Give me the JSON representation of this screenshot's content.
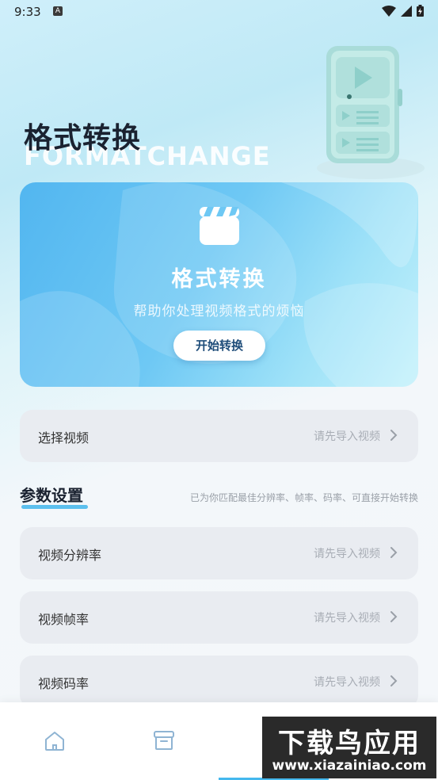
{
  "status_bar": {
    "time": "9:33",
    "notification_icon_label": "A"
  },
  "header": {
    "title": "格式转换",
    "subtitle": "FORMATCHANGE"
  },
  "banner": {
    "title": "格式转换",
    "description": "帮助你处理视频格式的烦恼",
    "button_label": "开始转换"
  },
  "select_video": {
    "label": "选择视频",
    "value": "请先导入视频"
  },
  "params": {
    "title": "参数设置",
    "hint": "已为你匹配最佳分辨率、帧率、码率、可直接开始转换",
    "rows": [
      {
        "label": "视频分辨率",
        "value": "请先导入视频"
      },
      {
        "label": "视频帧率",
        "value": "请先导入视频"
      },
      {
        "label": "视频码率",
        "value": "请先导入视频"
      }
    ]
  },
  "tabbar": {
    "tabs": [
      {
        "icon": "home-icon"
      },
      {
        "icon": "archive-icon"
      },
      {
        "icon": "convert-icon"
      },
      {
        "icon": "profile-icon"
      }
    ],
    "active_index": 2
  },
  "watermark": {
    "title": "下载鸟应用",
    "url": "www.xiazainiao.com"
  },
  "colors": {
    "accent": "#45b8ee",
    "banner_start": "#52b6f0",
    "banner_end": "#c2f1fb"
  }
}
